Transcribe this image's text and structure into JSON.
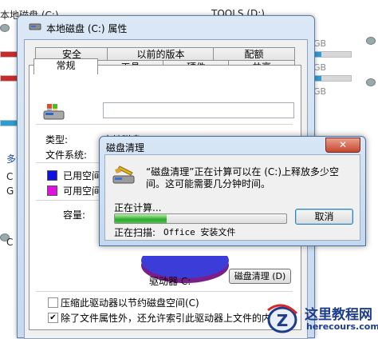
{
  "background": {
    "drive_c_label": "本地磁盘 (C:)",
    "drive_d_label": "TOOLS (D:)",
    "gb_labels": [
      "GB",
      "GB",
      "GB"
    ],
    "side_text_1": "多动",
    "side_text_2": "C",
    "side_text_3": "G",
    "side_text_4": "C"
  },
  "properties": {
    "title": "本地磁盘 (C:) 属性",
    "tabs_row1": [
      "安全",
      "以前的版本",
      "配额"
    ],
    "tabs_row2": [
      "常规",
      "工具",
      "硬件",
      "共享"
    ],
    "type_label": "类型:",
    "type_value": "本地磁盘",
    "fs_label": "文件系统:",
    "used_label": "已用空间",
    "free_label": "可用空间",
    "capacity_label": "容量:",
    "drive_label": "驱动器 C:",
    "cleanup_button": "磁盘清理 (D)",
    "compress_label": "压缩此驱动器以节约磁盘空间(C)",
    "index_label": "除了文件属性外，还允许索引此驱动器上文件的内",
    "compress_checked": false,
    "index_checked": true,
    "used_color": "#1010e0",
    "free_color": "#e010e0"
  },
  "cleanup_dialog": {
    "title": "磁盘清理",
    "close_label": "✕",
    "message_line1": "“磁盘清理”正在计算可以在 (C:)上释放多少空",
    "message_line2": "间。这可能需要几分钟时间。",
    "calculating_label": "正在计算...",
    "progress": 0.3,
    "cancel_button": "取消",
    "scanning_label": "正在扫描:",
    "scanning_value": "Office 安装文件"
  },
  "watermark": {
    "site_name": "这里教程网",
    "site_url": "herecours.com"
  }
}
